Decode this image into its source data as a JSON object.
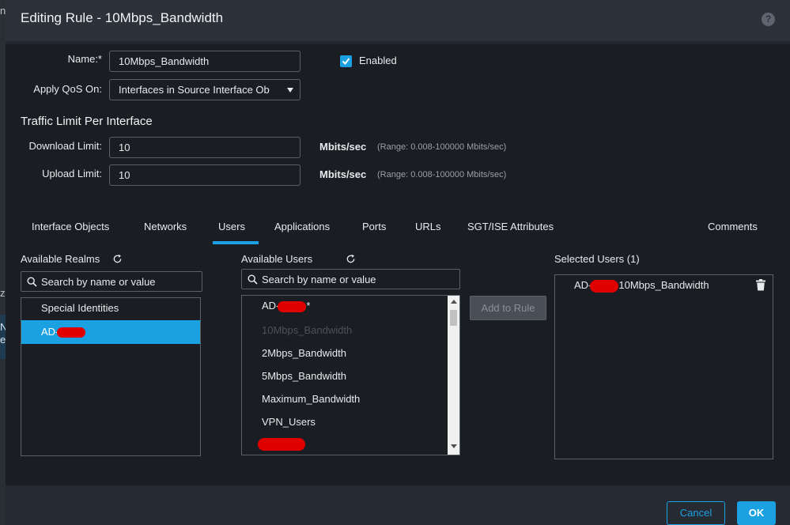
{
  "dialog": {
    "title": "Editing Rule - 10Mbps_Bandwidth",
    "help_icon_glyph": "?"
  },
  "form": {
    "name_label": "Name:*",
    "name_value": "10Mbps_Bandwidth",
    "enabled_label": "Enabled",
    "enabled_checked": true,
    "apply_qos_label": "Apply QoS On:",
    "apply_qos_value": "Interfaces in Source Interface Ob",
    "traffic_section_title": "Traffic Limit Per Interface",
    "download_label": "Download Limit:",
    "download_value": "10",
    "upload_label": "Upload Limit:",
    "upload_value": "10",
    "unit": "Mbits/sec",
    "range_hint": "(Range: 0.008-100000 Mbits/sec)"
  },
  "tabs": [
    {
      "label": "Interface Objects"
    },
    {
      "label": "Networks"
    },
    {
      "label": "Users",
      "active": true
    },
    {
      "label": "Applications"
    },
    {
      "label": "Ports"
    },
    {
      "label": "URLs"
    },
    {
      "label": "SGT/ISE Attributes"
    },
    {
      "label": "Comments"
    }
  ],
  "realms": {
    "title": "Available Realms",
    "search_placeholder": "Search by name or value",
    "items": [
      {
        "prefix": "Special Identities",
        "redacted": false
      },
      {
        "prefix": "AD-",
        "redacted": true,
        "selected": true
      }
    ]
  },
  "available_users": {
    "title": "Available Users",
    "search_placeholder": "Search by name or value",
    "items": [
      {
        "prefix": "AD-",
        "redacted": true,
        "suffix": "*"
      },
      {
        "prefix": "10Mbps_Bandwidth",
        "disabled": true
      },
      {
        "prefix": "2Mbps_Bandwidth"
      },
      {
        "prefix": "5Mbps_Bandwidth"
      },
      {
        "prefix": "Maximum_Bandwidth"
      },
      {
        "prefix": "VPN_Users"
      },
      {
        "prefix": "",
        "redacted": true
      }
    ],
    "add_button": "Add to Rule"
  },
  "selected_users": {
    "title": "Selected Users (1)",
    "items": [
      {
        "prefix": "AD-",
        "redacted": true,
        "suffix": "10Mbps_Bandwidth"
      }
    ]
  },
  "footer": {
    "cancel_label": "Cancel",
    "ok_label": "OK"
  },
  "colors": {
    "accent": "#1ba0e2",
    "redaction": "#e00000",
    "background": "#1a1d22"
  },
  "backdrop_fragments": [
    "n",
    "z",
    "N",
    "e"
  ]
}
